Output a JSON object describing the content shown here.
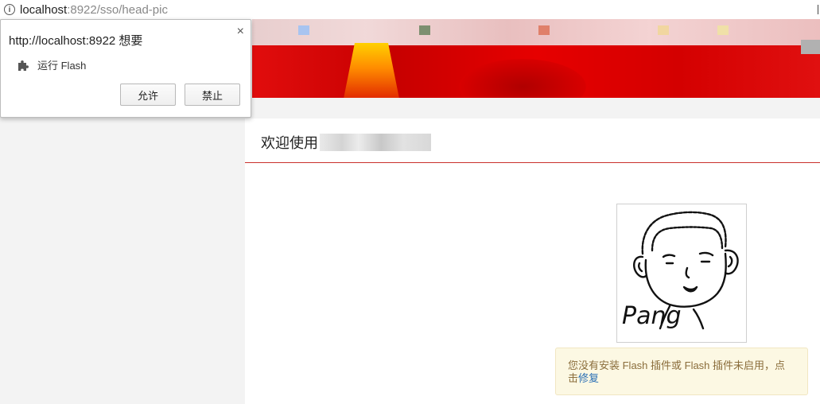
{
  "address_bar": {
    "host": "localhost",
    "path": ":8922/sso/head-pic"
  },
  "popup": {
    "title": "http://localhost:8922 想要",
    "permission_label": "运行 Flash",
    "allow_label": "允许",
    "block_label": "禁止",
    "close_glyph": "×"
  },
  "content": {
    "welcome_text": "欢迎使用",
    "avatar_caption": "Pang",
    "flash_notice": "您没有安装 Flash 插件或 Flash 插件未启用，点击",
    "flash_fix_link": "修复"
  },
  "colors": {
    "banner_red": "#e10d0d",
    "divider_red": "#c9302c",
    "alert_bg": "#fcf8e3",
    "link_blue": "#2a6fb5"
  }
}
